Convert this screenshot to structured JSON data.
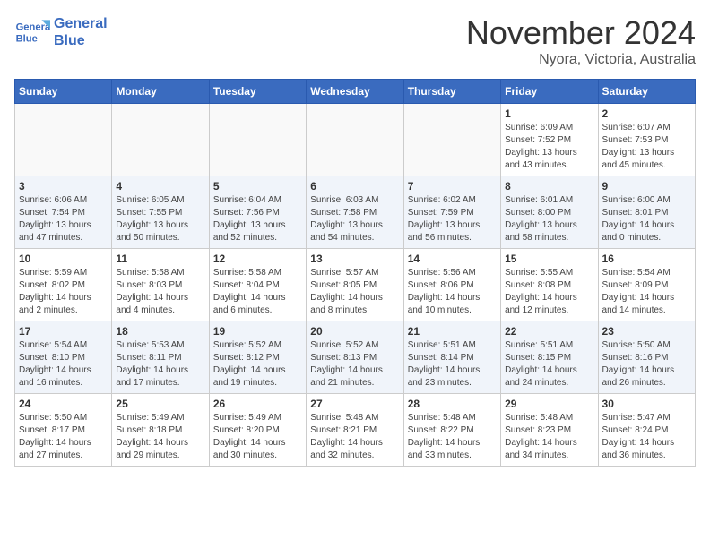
{
  "logo": {
    "line1": "General",
    "line2": "Blue"
  },
  "header": {
    "month": "November 2024",
    "location": "Nyora, Victoria, Australia"
  },
  "weekdays": [
    "Sunday",
    "Monday",
    "Tuesday",
    "Wednesday",
    "Thursday",
    "Friday",
    "Saturday"
  ],
  "weeks": [
    [
      {
        "day": "",
        "info": ""
      },
      {
        "day": "",
        "info": ""
      },
      {
        "day": "",
        "info": ""
      },
      {
        "day": "",
        "info": ""
      },
      {
        "day": "",
        "info": ""
      },
      {
        "day": "1",
        "info": "Sunrise: 6:09 AM\nSunset: 7:52 PM\nDaylight: 13 hours\nand 43 minutes."
      },
      {
        "day": "2",
        "info": "Sunrise: 6:07 AM\nSunset: 7:53 PM\nDaylight: 13 hours\nand 45 minutes."
      }
    ],
    [
      {
        "day": "3",
        "info": "Sunrise: 6:06 AM\nSunset: 7:54 PM\nDaylight: 13 hours\nand 47 minutes."
      },
      {
        "day": "4",
        "info": "Sunrise: 6:05 AM\nSunset: 7:55 PM\nDaylight: 13 hours\nand 50 minutes."
      },
      {
        "day": "5",
        "info": "Sunrise: 6:04 AM\nSunset: 7:56 PM\nDaylight: 13 hours\nand 52 minutes."
      },
      {
        "day": "6",
        "info": "Sunrise: 6:03 AM\nSunset: 7:58 PM\nDaylight: 13 hours\nand 54 minutes."
      },
      {
        "day": "7",
        "info": "Sunrise: 6:02 AM\nSunset: 7:59 PM\nDaylight: 13 hours\nand 56 minutes."
      },
      {
        "day": "8",
        "info": "Sunrise: 6:01 AM\nSunset: 8:00 PM\nDaylight: 13 hours\nand 58 minutes."
      },
      {
        "day": "9",
        "info": "Sunrise: 6:00 AM\nSunset: 8:01 PM\nDaylight: 14 hours\nand 0 minutes."
      }
    ],
    [
      {
        "day": "10",
        "info": "Sunrise: 5:59 AM\nSunset: 8:02 PM\nDaylight: 14 hours\nand 2 minutes."
      },
      {
        "day": "11",
        "info": "Sunrise: 5:58 AM\nSunset: 8:03 PM\nDaylight: 14 hours\nand 4 minutes."
      },
      {
        "day": "12",
        "info": "Sunrise: 5:58 AM\nSunset: 8:04 PM\nDaylight: 14 hours\nand 6 minutes."
      },
      {
        "day": "13",
        "info": "Sunrise: 5:57 AM\nSunset: 8:05 PM\nDaylight: 14 hours\nand 8 minutes."
      },
      {
        "day": "14",
        "info": "Sunrise: 5:56 AM\nSunset: 8:06 PM\nDaylight: 14 hours\nand 10 minutes."
      },
      {
        "day": "15",
        "info": "Sunrise: 5:55 AM\nSunset: 8:08 PM\nDaylight: 14 hours\nand 12 minutes."
      },
      {
        "day": "16",
        "info": "Sunrise: 5:54 AM\nSunset: 8:09 PM\nDaylight: 14 hours\nand 14 minutes."
      }
    ],
    [
      {
        "day": "17",
        "info": "Sunrise: 5:54 AM\nSunset: 8:10 PM\nDaylight: 14 hours\nand 16 minutes."
      },
      {
        "day": "18",
        "info": "Sunrise: 5:53 AM\nSunset: 8:11 PM\nDaylight: 14 hours\nand 17 minutes."
      },
      {
        "day": "19",
        "info": "Sunrise: 5:52 AM\nSunset: 8:12 PM\nDaylight: 14 hours\nand 19 minutes."
      },
      {
        "day": "20",
        "info": "Sunrise: 5:52 AM\nSunset: 8:13 PM\nDaylight: 14 hours\nand 21 minutes."
      },
      {
        "day": "21",
        "info": "Sunrise: 5:51 AM\nSunset: 8:14 PM\nDaylight: 14 hours\nand 23 minutes."
      },
      {
        "day": "22",
        "info": "Sunrise: 5:51 AM\nSunset: 8:15 PM\nDaylight: 14 hours\nand 24 minutes."
      },
      {
        "day": "23",
        "info": "Sunrise: 5:50 AM\nSunset: 8:16 PM\nDaylight: 14 hours\nand 26 minutes."
      }
    ],
    [
      {
        "day": "24",
        "info": "Sunrise: 5:50 AM\nSunset: 8:17 PM\nDaylight: 14 hours\nand 27 minutes."
      },
      {
        "day": "25",
        "info": "Sunrise: 5:49 AM\nSunset: 8:18 PM\nDaylight: 14 hours\nand 29 minutes."
      },
      {
        "day": "26",
        "info": "Sunrise: 5:49 AM\nSunset: 8:20 PM\nDaylight: 14 hours\nand 30 minutes."
      },
      {
        "day": "27",
        "info": "Sunrise: 5:48 AM\nSunset: 8:21 PM\nDaylight: 14 hours\nand 32 minutes."
      },
      {
        "day": "28",
        "info": "Sunrise: 5:48 AM\nSunset: 8:22 PM\nDaylight: 14 hours\nand 33 minutes."
      },
      {
        "day": "29",
        "info": "Sunrise: 5:48 AM\nSunset: 8:23 PM\nDaylight: 14 hours\nand 34 minutes."
      },
      {
        "day": "30",
        "info": "Sunrise: 5:47 AM\nSunset: 8:24 PM\nDaylight: 14 hours\nand 36 minutes."
      }
    ]
  ]
}
